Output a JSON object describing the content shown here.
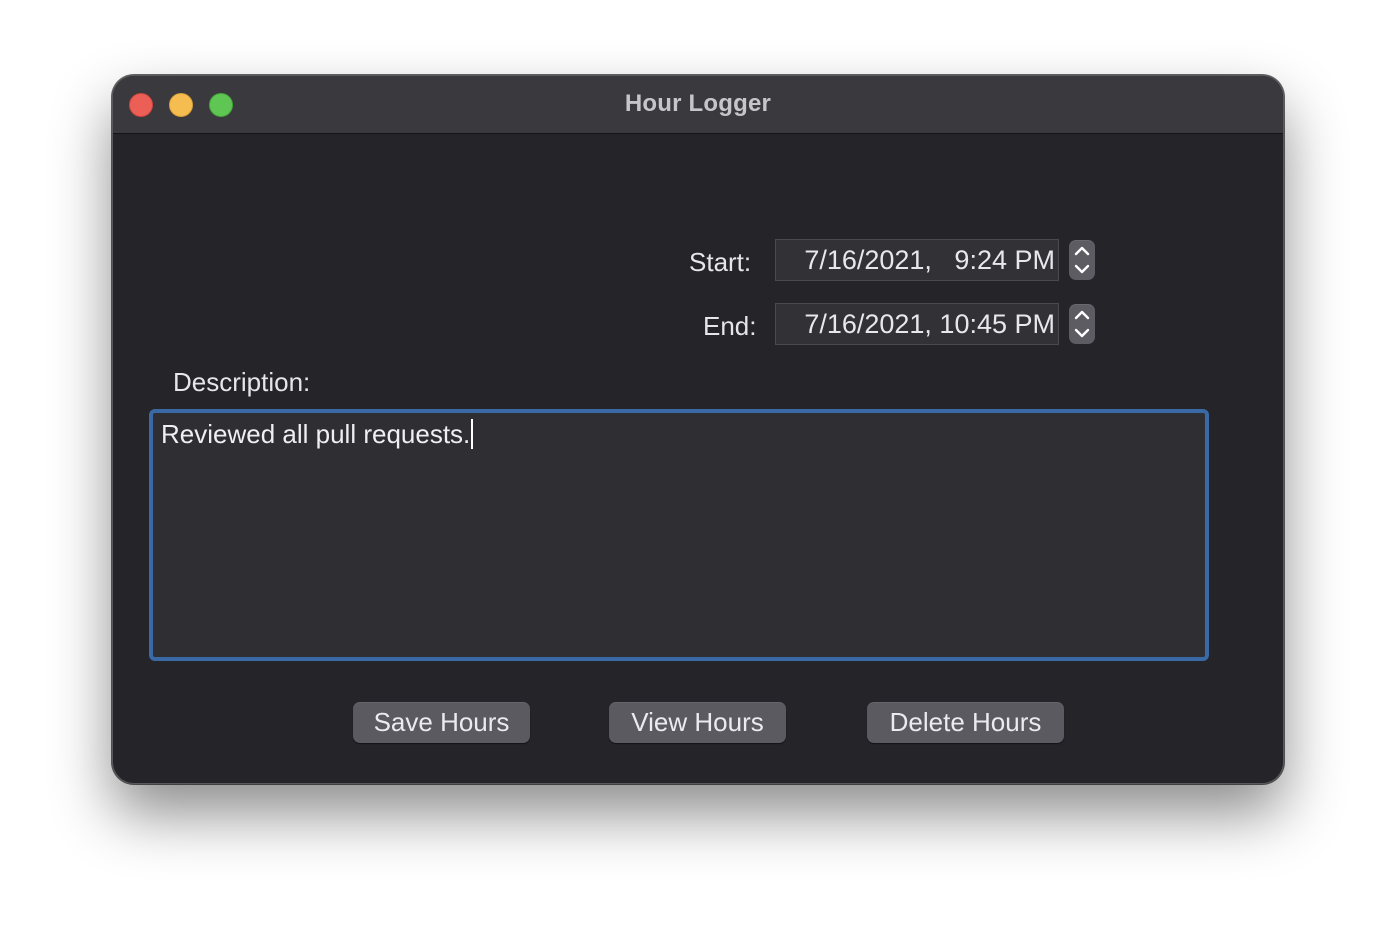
{
  "window": {
    "title": "Hour Logger"
  },
  "form": {
    "start_label": "Start:",
    "start_value": "7/16/2021,   9:24 PM",
    "end_label": "End:",
    "end_value": "7/16/2021, 10:45 PM",
    "description_label": "Description:",
    "description_value": "Reviewed all pull requests."
  },
  "buttons": {
    "save": "Save Hours",
    "view": "View Hours",
    "delete": "Delete Hours"
  },
  "icons": {
    "close": "close-button-red",
    "minimize": "minimize-button-yellow",
    "zoom": "zoom-button-green",
    "stepper": "up-down-chevron-icon"
  },
  "colors": {
    "focus_ring": "#3a6aa6",
    "window_bg": "#252429"
  }
}
